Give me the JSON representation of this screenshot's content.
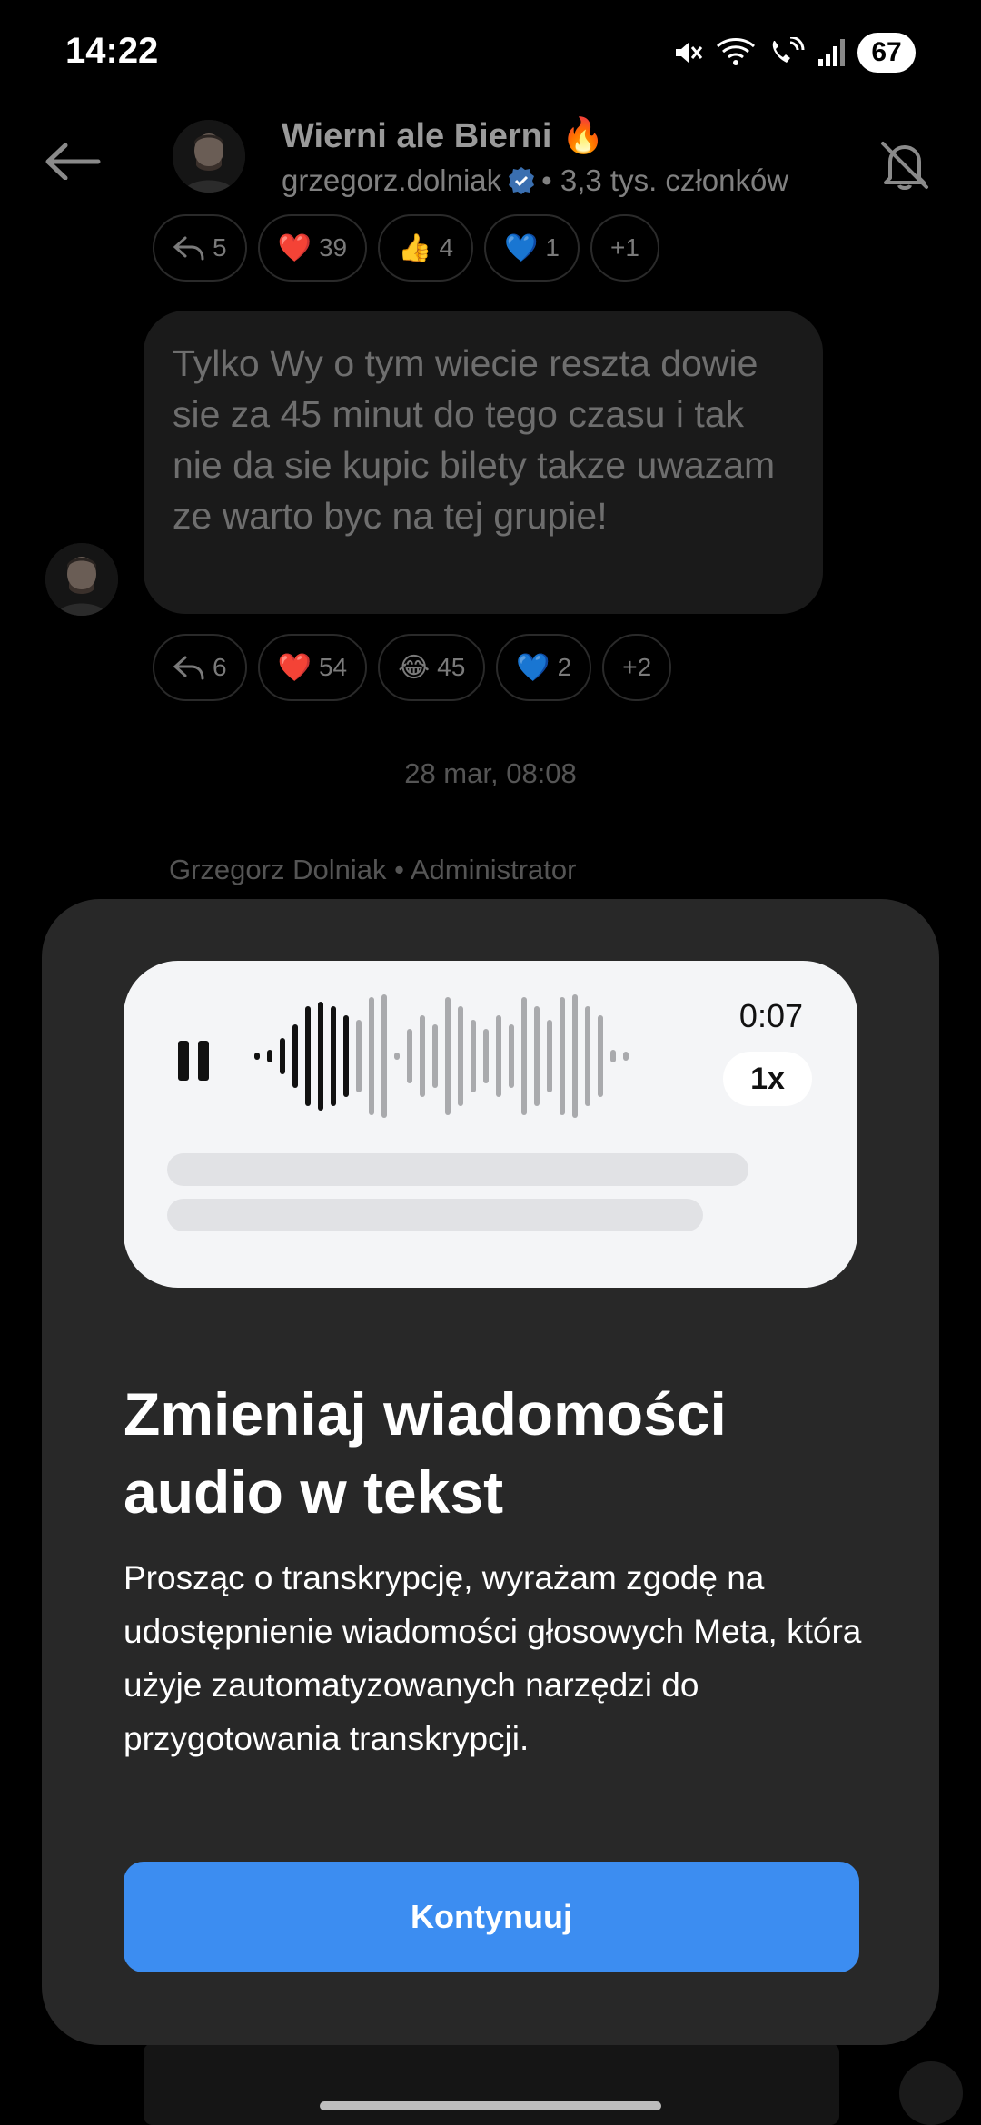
{
  "status_bar": {
    "time": "14:22",
    "battery": "67",
    "icons": [
      "mute-icon",
      "wifi-icon",
      "wifi-calling-icon",
      "signal-icon",
      "battery-icon"
    ]
  },
  "header": {
    "group_name": "Wierni ale Bierni",
    "group_emoji": "🔥",
    "admin_handle": "grzegorz.dolniak",
    "members": "• 3,3 tys. członków",
    "icons": [
      "back-arrow-icon",
      "avatar",
      "verified-badge-icon",
      "bell-off-icon"
    ]
  },
  "chat": {
    "reactions_top": [
      {
        "icon": "reply-icon",
        "emoji": "",
        "count": "5"
      },
      {
        "icon": "heart",
        "emoji": "❤️",
        "count": "39"
      },
      {
        "icon": "thumbs-up",
        "emoji": "👍",
        "count": "4"
      },
      {
        "icon": "blue-heart",
        "emoji": "💙",
        "count": "1"
      },
      {
        "icon": "",
        "emoji": "",
        "count": "+1"
      }
    ],
    "message_text": "Tylko Wy o tym wiecie reszta dowie sie za 45 minut do tego czasu i tak nie da sie kupic bilety takze uwazam ze warto byc na tej grupie!",
    "reactions_bottom": [
      {
        "icon": "reply-icon",
        "emoji": "",
        "count": "6"
      },
      {
        "icon": "heart",
        "emoji": "❤️",
        "count": "54"
      },
      {
        "icon": "laughing",
        "emoji": "😂",
        "count": "45"
      },
      {
        "icon": "blue-heart",
        "emoji": "💙",
        "count": "2"
      },
      {
        "icon": "",
        "emoji": "",
        "count": "+2"
      }
    ],
    "date": "28 mar, 08:08",
    "sender_line": "Grzegorz Dolniak • Administrator"
  },
  "sheet": {
    "audio_time": "0:07",
    "speed": "1x",
    "title": "Zmieniaj wiadomości audio w tekst",
    "body": "Prosząc o transkrypcję, wyrażam zgodę na udostępnienie wiadomości głosowych Meta, która użyje zautomatyzowanych narzędzi do przygotowania transkrypcji.",
    "button": "Kontynuuj"
  },
  "colors": {
    "background": "#000000",
    "sheet": "#282828",
    "audio_card": "#f4f5f7",
    "primary_button": "#3c8df1",
    "verified": "#3897f0"
  }
}
